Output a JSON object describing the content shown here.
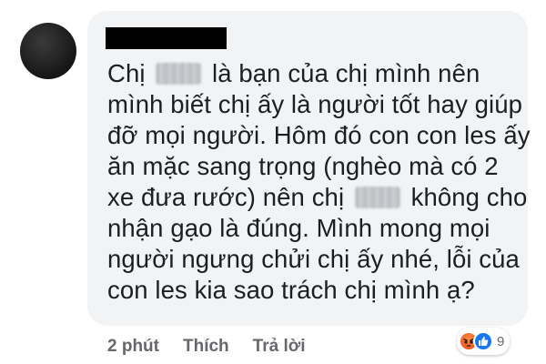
{
  "comment": {
    "author_name": "",
    "text_lines": [
      [
        "Chị ",
        "",
        " là bạn của chị mình nên"
      ],
      [
        "mình biết chị ấy là người tốt hay giúp"
      ],
      [
        "đỡ mọi người. Hôm đó con con les ấy"
      ],
      [
        "ăn mặc sang trọng (nghèo mà có 2"
      ],
      [
        "xe đưa rước) nên chị ",
        "",
        " không cho"
      ],
      [
        "nhận gạo là đúng. Mình mong mọi"
      ],
      [
        "người ngưng chửi chị ấy nhé, lỗi của"
      ],
      [
        "con les kia sao trách chị mình ạ?"
      ]
    ]
  },
  "reactions": {
    "icons": [
      "angry-icon",
      "like-icon"
    ],
    "count": "9",
    "colors": {
      "angry": "#f0642a",
      "like": "#1877f2"
    }
  },
  "actions": {
    "time": "2 phút",
    "like_label": "Thích",
    "reply_label": "Trả lời"
  },
  "colors": {
    "bubble": "#f2f3f5",
    "text": "#1c1e21",
    "meta": "#65676b"
  }
}
